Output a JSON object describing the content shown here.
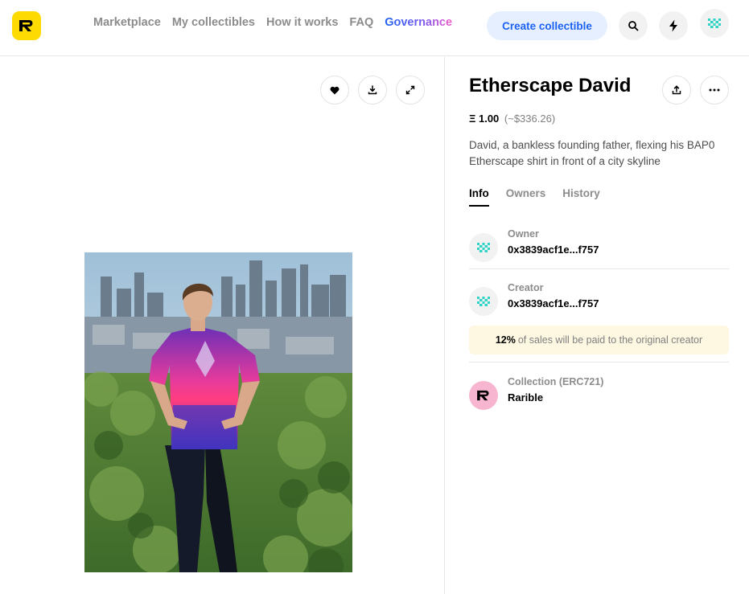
{
  "header": {
    "logo_letter": "R",
    "nav": [
      {
        "label": "Marketplace"
      },
      {
        "label": "My collectibles"
      },
      {
        "label": "How it works"
      },
      {
        "label": "FAQ"
      },
      {
        "label": "Governance"
      }
    ],
    "create_label": "Create collectible",
    "icons": [
      "search-icon",
      "lightning-icon",
      "avatar"
    ]
  },
  "item": {
    "title": "Etherscape David",
    "price_eth": "Ξ 1.00",
    "price_usd": "(~$336.26)",
    "description": "David, a bankless founding father, flexing his BAP0 Etherscape shirt in front of a city skyline",
    "media_controls": [
      "heart-icon",
      "download-icon",
      "expand-icon"
    ]
  },
  "tabs": [
    {
      "label": "Info",
      "active": true
    },
    {
      "label": "Owners",
      "active": false
    },
    {
      "label": "History",
      "active": false
    }
  ],
  "info": {
    "owner": {
      "label": "Owner",
      "value": "0x3839acf1e...f757"
    },
    "creator": {
      "label": "Creator",
      "value": "0x3839acf1e...f757"
    },
    "royalty_percent": "12%",
    "royalty_text": "of sales will be paid to the original creator",
    "collection": {
      "label": "Collection (ERC721)",
      "value": "Rarible"
    }
  },
  "colors": {
    "brand_yellow": "#FEDA03",
    "accent_blue": "#1e63f0",
    "avatar_teal": "#2fd3c6",
    "royalty_bg": "#fef8e2"
  }
}
